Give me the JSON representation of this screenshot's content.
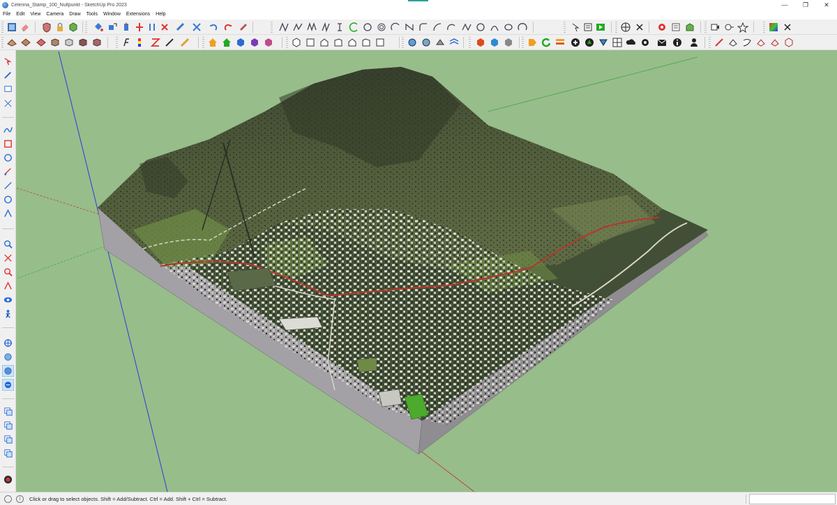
{
  "window": {
    "title": "Celerina_Stamp_100_Nullpunkt - SketchUp Pro 2023",
    "minimize": "—",
    "restore": "❐",
    "close": "✕"
  },
  "menu": [
    "File",
    "Edit",
    "View",
    "Camera",
    "Draw",
    "Tools",
    "Window",
    "Extensions",
    "Help"
  ],
  "statusbar": {
    "message": "Click or drag to select objects. Shift = Add/Subtract. Ctrl = Add. Shift + Ctrl = Subtract.",
    "info_icon": "i",
    "measurements_value": ""
  },
  "icons": {
    "geo_location": "geo-location-icon",
    "select": "select-icon",
    "orbit": "orbit-icon"
  },
  "colors": {
    "sky_ground": "#97bd8b",
    "terrain_dark": "#3f4a30",
    "terrain_mid": "#5f6a44",
    "meadow": "#6e8a45",
    "road_red": "#b03a2e",
    "path_light": "#d9d6c7",
    "soil_edge": "#9a989c",
    "axis_green": "#3aa83a",
    "axis_blue": "#2e3bd6",
    "axis_red": "#c0392b"
  }
}
